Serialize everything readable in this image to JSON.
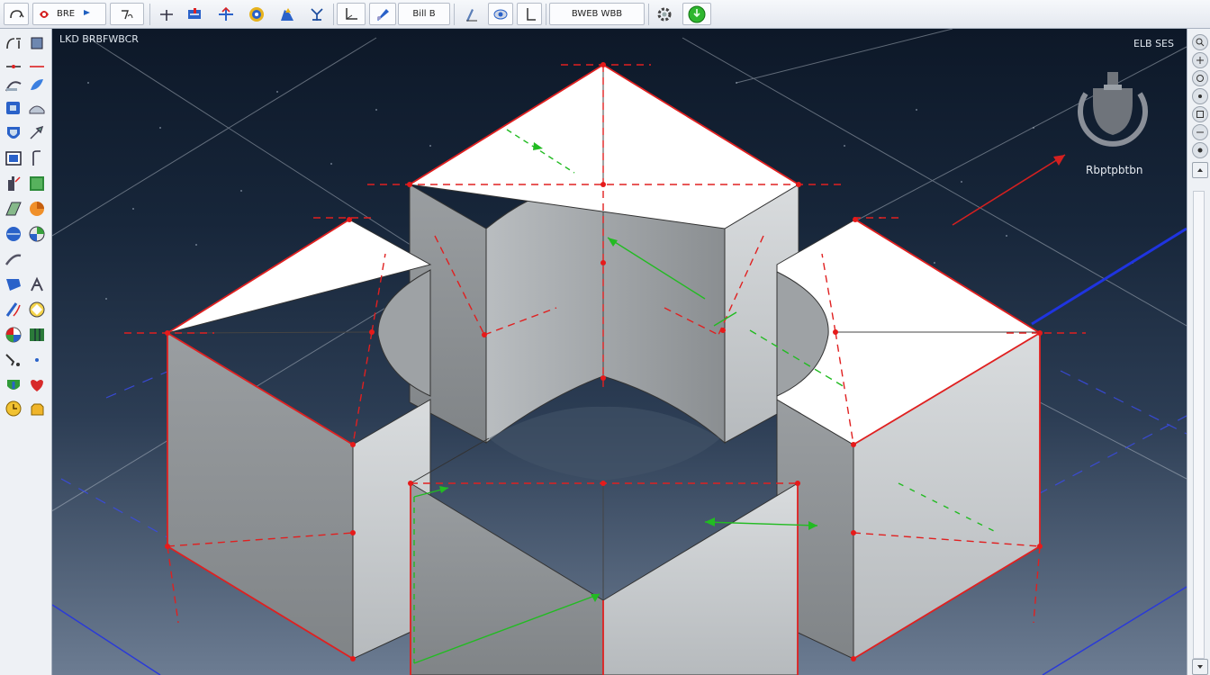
{
  "toolbar": {
    "group1_label": "BRE",
    "group2_label": "Bill B",
    "group3_label": "BWEB WBB"
  },
  "viewport": {
    "title": "LKD BRBFWBCR",
    "corner_text": "ELB SES",
    "view_cube_label": "Rbptpbtbn"
  },
  "colors": {
    "accent_red": "#e02020",
    "accent_green": "#22bb22",
    "accent_blue": "#2233cc",
    "solid_top": "#ffffff",
    "solid_side_dark": "#8f9396",
    "solid_side_light": "#c9cdd0"
  },
  "icons": {
    "palette": [
      "arc-tool-icon",
      "box-tool-icon",
      "line-tool-icon",
      "measure-tool-icon",
      "sketch-tool-icon",
      "surface-tool-icon",
      "extrude-tool-icon",
      "sweep-tool-icon",
      "shell-tool-icon",
      "rib-tool-icon",
      "wall-tool-icon",
      "fillet-tool-icon",
      "pocket-tool-icon",
      "plane-tool-icon",
      "sphere-tool-icon",
      "sector-tool-icon",
      "link-tool-icon",
      "mirror-tool-icon",
      "curve-tool-icon",
      "pattern-tool-icon",
      "render-tool-icon",
      "assembly-tool-icon",
      "snap-tool-icon",
      "point-tool-icon",
      "material-tool-icon",
      "paint-tool-icon",
      "compass-tool-icon",
      "part-tool-icon"
    ],
    "right_strip": [
      "zoom-icon",
      "pan-icon",
      "orbit-icon",
      "look-icon",
      "fit-icon",
      "view-icon",
      "settings-icon"
    ]
  }
}
